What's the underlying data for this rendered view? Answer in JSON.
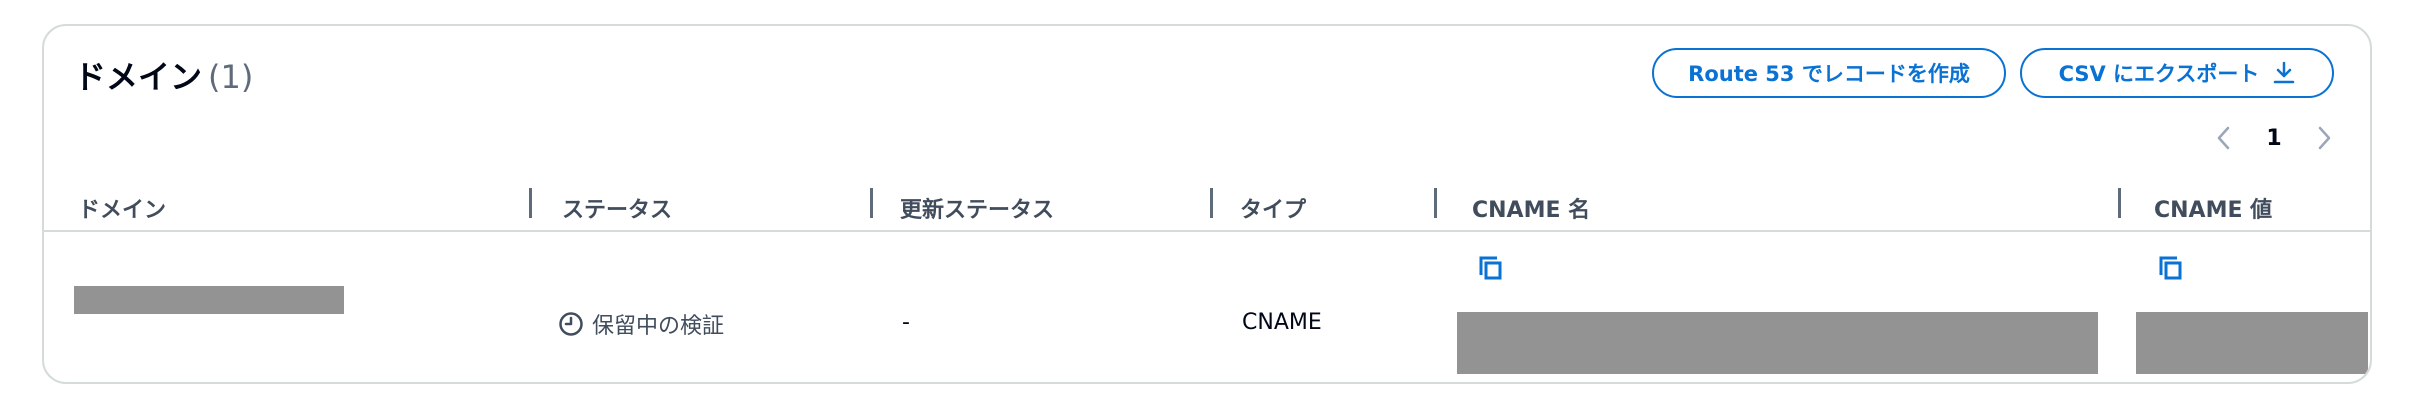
{
  "panel": {
    "title": "ドメイン",
    "count": "(1)"
  },
  "buttons": {
    "route53_label": "Route 53 でレコードを作成",
    "export_csv_label": "CSV にエクスポート"
  },
  "pagination": {
    "current_page": "1"
  },
  "table": {
    "columns": [
      "ドメイン",
      "ステータス",
      "更新ステータス",
      "タイプ",
      "CNAME 名",
      "CNAME 値"
    ],
    "rows": [
      {
        "domain": "",
        "status": "保留中の検証",
        "renewal_status": "-",
        "type": "CNAME",
        "cname_name": "",
        "cname_value": ""
      }
    ]
  },
  "icons": {
    "status_icon": "clock-icon",
    "copy_icon": "copy-icon",
    "download_icon": "download-icon",
    "prev_icon": "chevron-left-icon",
    "next_icon": "chevron-right-icon"
  },
  "colors": {
    "accent": "#0972d3",
    "border": "#d5dbdb",
    "redaction": "#939393"
  }
}
